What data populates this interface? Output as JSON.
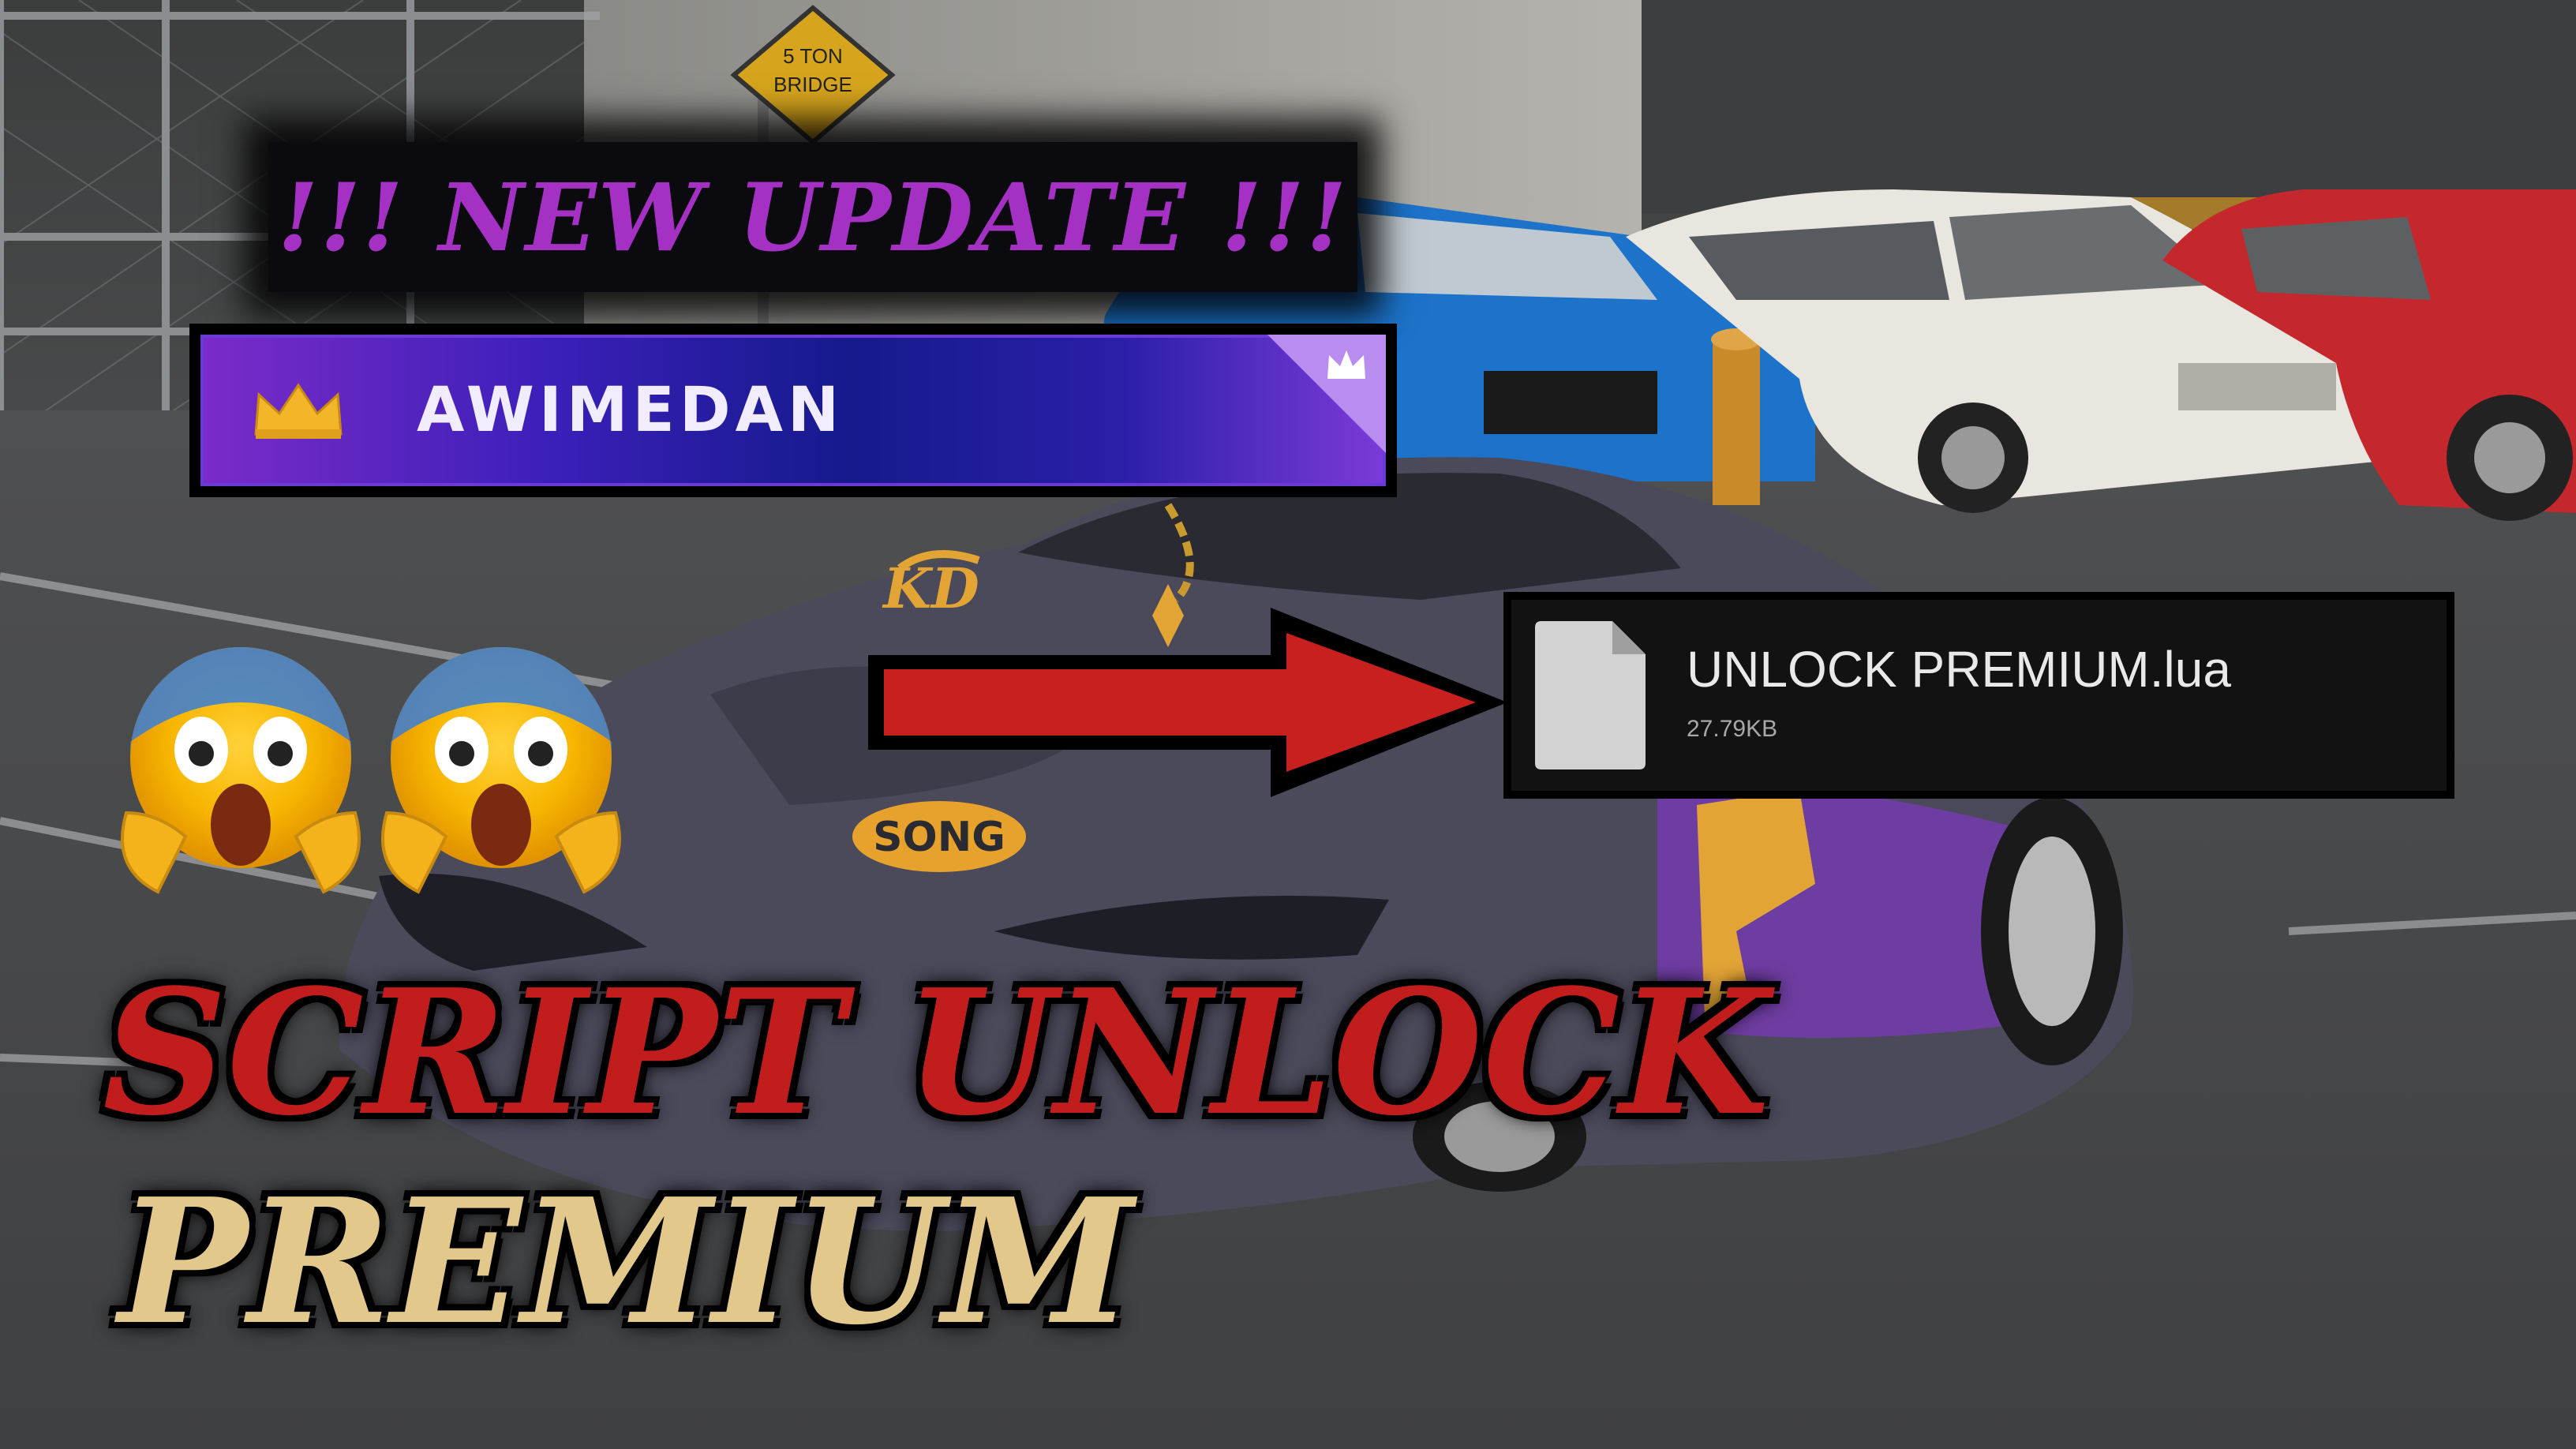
{
  "headline": {
    "text": "!!! NEW UPDATE !!!",
    "color": "#a531c4"
  },
  "player_plate": {
    "name": "AWIMEDAN",
    "icon": "crown-icon"
  },
  "file_card": {
    "file_name": "UNLOCK PREMIUM.lua",
    "file_size": "27.79KB",
    "icon": "file-icon"
  },
  "arrow": {
    "icon": "arrow-right-icon",
    "color": "#c8201f"
  },
  "emojis": [
    "screaming-face-icon",
    "screaming-face-icon"
  ],
  "title": {
    "line1": "SCRIPT UNLOCK",
    "line2": "PREMIUM",
    "line1_color": "#c21d1d",
    "line2_color": "#e2c88a"
  },
  "background": {
    "road_sign_line1": "5 TON",
    "road_sign_line2": "BRIDGE"
  }
}
